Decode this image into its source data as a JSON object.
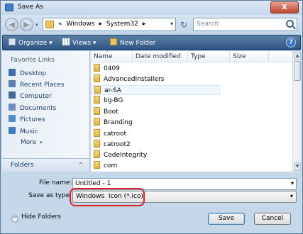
{
  "window": {
    "title": "Save As",
    "close_label": "X"
  },
  "address": {
    "back_icon": "back-arrow-icon",
    "forward_icon": "forward-arrow-icon",
    "prefix": "«",
    "path": [
      "Windows",
      "System32"
    ],
    "separator": "▸",
    "dropdown": "▾",
    "refresh_glyph": "↻",
    "search_placeholder": "Search"
  },
  "toolbar": {
    "organize_label": "Organize",
    "views_label": "Views",
    "new_folder_label": "New Folder",
    "dropdown": "▾",
    "help_label": "?"
  },
  "sidebar": {
    "title": "Favorite Links",
    "items": [
      {
        "label": "Desktop",
        "color": "#3f6fb0"
      },
      {
        "label": "Recent Places",
        "color": "#5a7fae"
      },
      {
        "label": "Computer",
        "color": "#456b94"
      },
      {
        "label": "Documents",
        "color": "#6e8fbf"
      },
      {
        "label": "Pictures",
        "color": "#4d8fc4"
      },
      {
        "label": "Music",
        "color": "#3c7ec0"
      }
    ],
    "more_label": "More",
    "more_glyph": "»",
    "folders_label": "Folders",
    "folders_arrow": "⌃"
  },
  "filelist": {
    "columns": [
      "Name",
      "Date modified",
      "Type",
      "Size"
    ],
    "sort_glyph": "⌃",
    "items": [
      "0409",
      "AdvancedInstallers",
      "ar-SA",
      "bg-BG",
      "Boot",
      "Branding",
      "catroot",
      "catroot2",
      "CodeIntegrity",
      "com"
    ],
    "hover_index": 2
  },
  "form": {
    "file_name_label": "File name:",
    "file_name_value": "Untitled - 1",
    "save_type_label": "Save as type:",
    "save_type_value": "Windows  Icon (*.ico)",
    "arrow": "▾",
    "highlight_color": "#e02020"
  },
  "footer": {
    "hide_folders_label": "Hide Folders",
    "hide_glyph": "⌃",
    "save_label": "Save",
    "cancel_label": "Cancel"
  }
}
